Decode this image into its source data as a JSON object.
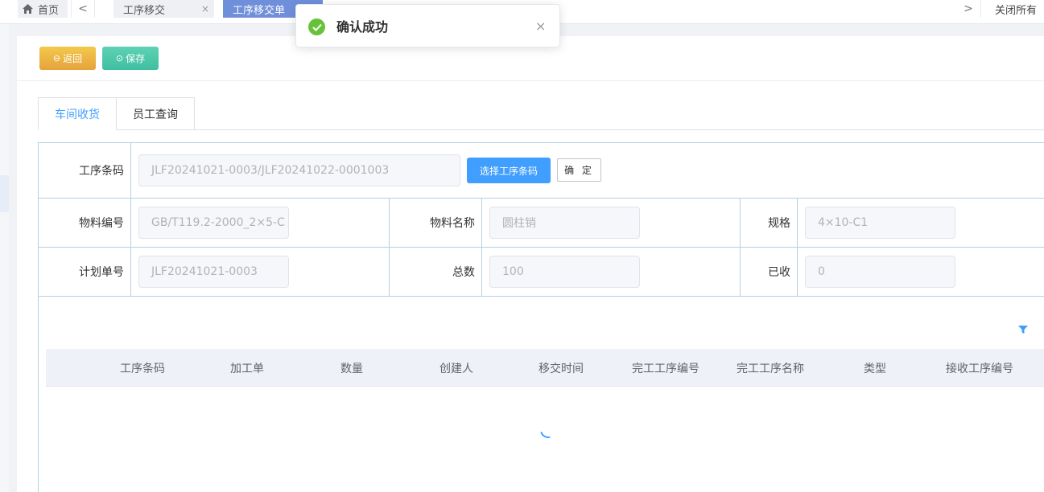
{
  "tabbar": {
    "home_label": "首页",
    "tabs": [
      {
        "label": "工序移交",
        "close": "×"
      },
      {
        "label": "工序移交单"
      }
    ],
    "prev_glyph": "<",
    "next_glyph": ">",
    "close_all_label": "关闭所有"
  },
  "toast": {
    "message": "确认成功",
    "close": "×",
    "icon": "check-circle-icon",
    "color": "#67c23a"
  },
  "toolbar": {
    "back_label": "返回",
    "save_label": "保存",
    "back_icon_glyph": "⊖",
    "save_icon_glyph": "⊙"
  },
  "tabs": [
    {
      "label": "车间收货",
      "active": true
    },
    {
      "label": "员工查询",
      "active": false
    }
  ],
  "form": {
    "process_code_label": "工序条码",
    "process_code_value": "JLF20241021-0003/JLF20241022-0001003",
    "pick_button": "选择工序条码",
    "confirm_button": "确 定",
    "material_no_label": "物料编号",
    "material_no_value": "GB/T119.2-2000_2×5-C",
    "material_name_label": "物料名称",
    "material_name_value": "圆柱销",
    "spec_label": "规格",
    "spec_value": "4×10-C1",
    "plan_no_label": "计划单号",
    "plan_no_value": "JLF20241021-0003",
    "total_label": "总数",
    "total_value": "100",
    "received_label": "已收",
    "received_value": "0"
  },
  "table": {
    "columns": [
      "工序条码",
      "加工单",
      "数量",
      "创建人",
      "移交时间",
      "完工工序编号",
      "完工工序名称",
      "类型",
      "接收工序编号"
    ]
  },
  "colors": {
    "primary": "#409eff",
    "active_tab": "#6f8fdb",
    "back_button": "#e6a23c",
    "save_button": "#3fbfa0"
  }
}
